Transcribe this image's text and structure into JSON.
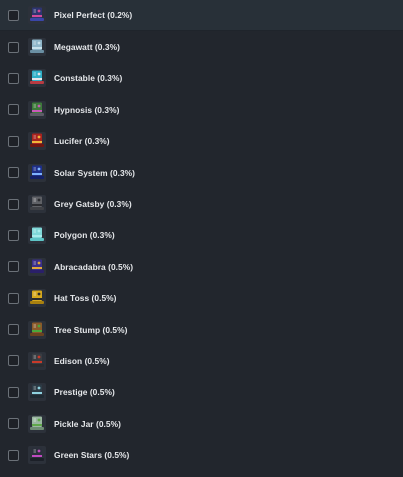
{
  "hat_list": {
    "items": [
      {
        "label": "Pixel Perfect (0.2%)",
        "icon": "pixel-perfect-hat-icon",
        "crown": "#2d3470",
        "brim": "#3a46a8",
        "accent": "#d04a9a",
        "selected": false
      },
      {
        "label": "Megawatt (0.3%)",
        "icon": "megawatt-hat-icon",
        "crown": "#8fb6c9",
        "brim": "#6a8fa3",
        "accent": "#c9e2ec",
        "selected": false
      },
      {
        "label": "Constable (0.3%)",
        "icon": "constable-hat-icon",
        "crown": "#2fb0c8",
        "brim": "#b73b42",
        "accent": "#e2e6ea",
        "selected": false
      },
      {
        "label": "Hypnosis (0.3%)",
        "icon": "hypnosis-hat-icon",
        "crown": "#3d7a3a",
        "brim": "#5c5c66",
        "accent": "#c85ab8",
        "selected": false
      },
      {
        "label": "Lucifer (0.3%)",
        "icon": "lucifer-hat-icon",
        "crown": "#a8231f",
        "brim": "#6e1612",
        "accent": "#f0b63a",
        "selected": false
      },
      {
        "label": "Solar System (0.3%)",
        "icon": "solar-system-hat-icon",
        "crown": "#1e2f8a",
        "brim": "#142066",
        "accent": "#7fb3ff",
        "selected": false
      },
      {
        "label": "Grey Gatsby (0.3%)",
        "icon": "grey-gatsby-hat-icon",
        "crown": "#5f6166",
        "brim": "#3f4146",
        "accent": "#2b2c30",
        "selected": false
      },
      {
        "label": "Polygon (0.3%)",
        "icon": "polygon-hat-icon",
        "crown": "#7fd8d8",
        "brim": "#5ec4c6",
        "accent": "#a8ecec",
        "selected": false
      },
      {
        "label": "Abracadabra (0.5%)",
        "icon": "abracadabra-hat-icon",
        "crown": "#3a2e8a",
        "brim": "#2a1f6a",
        "accent": "#e0a83a",
        "selected": false
      },
      {
        "label": "Hat Toss (0.5%)",
        "icon": "hat-toss-hat-icon",
        "crown": "#d6a81e",
        "brim": "#a8800f",
        "accent": "#2a2a2a",
        "selected": false
      },
      {
        "label": "Tree Stump (0.5%)",
        "icon": "tree-stump-hat-icon",
        "crown": "#8a5a2a",
        "brim": "#6a4220",
        "accent": "#4aa83a",
        "selected": false
      },
      {
        "label": "Edison (0.5%)",
        "icon": "edison-hat-icon",
        "crown": "#3a3d42",
        "brim": "#2a2c30",
        "accent": "#c83a2a",
        "selected": false
      },
      {
        "label": "Prestige (0.5%)",
        "icon": "prestige-hat-icon",
        "crown": "#2d3c46",
        "brim": "#1f2a32",
        "accent": "#8fd2e0",
        "selected": false
      },
      {
        "label": "Pickle Jar (0.5%)",
        "icon": "pickle-jar-hat-icon",
        "crown": "#9ab8a0",
        "brim": "#6e8c74",
        "accent": "#5fa84a",
        "selected": false
      },
      {
        "label": "Green Stars (0.5%)",
        "icon": "green-stars-hat-icon",
        "crown": "#2a2f3a",
        "brim": "#1c2028",
        "accent": "#c04ac0",
        "selected": false
      }
    ]
  }
}
